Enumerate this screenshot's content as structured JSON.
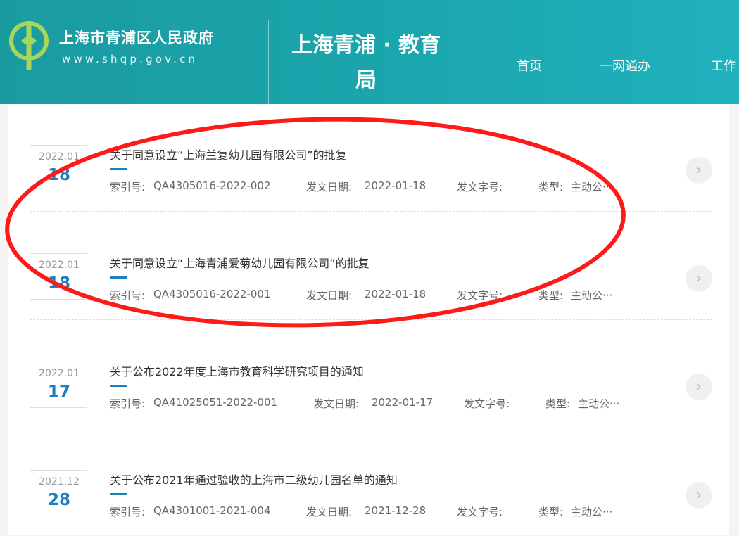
{
  "header": {
    "site_name": "上海市青浦区人民政府",
    "site_url": "www.shqp.gov.cn",
    "dept_title": "上海青浦 · 教育局",
    "nav": [
      "首页",
      "一网通办",
      "工作"
    ],
    "bg_color": "#1aa6ad"
  },
  "list": {
    "labels": {
      "index_prefix": "索引号:",
      "date_prefix": "发文日期:",
      "docno_prefix": "发文字号:",
      "type_prefix": "类型:"
    },
    "items": [
      {
        "year_month": "2022.01",
        "day": "18",
        "title": "关于同意设立“上海兰复幼儿园有限公司”的批复",
        "index_no": "QA4305016-2022-002",
        "date": "2022-01-18",
        "type": "主动公···"
      },
      {
        "year_month": "2022.01",
        "day": "18",
        "title": "关于同意设立“上海青浦爱菊幼儿园有限公司”的批复",
        "index_no": "QA4305016-2022-001",
        "date": "2022-01-18",
        "type": "主动公···"
      },
      {
        "year_month": "2022.01",
        "day": "17",
        "title": "关于公布2022年度上海市教育科学研究项目的通知",
        "index_no": "QA41025051-2022-001",
        "date": "2022-01-17",
        "type": "主动公···"
      },
      {
        "year_month": "2021.12",
        "day": "28",
        "title": "关于公布2021年通过验收的上海市二级幼儿园名单的通知",
        "index_no": "QA4301001-2021-004",
        "date": "2021-12-28",
        "type": "主动公···"
      }
    ]
  },
  "accent_color": "#1e7fc0",
  "annotation_color": "#ff1a1a",
  "icons": {
    "logo": "qingpu-logo-icon",
    "arrow": "chevron-right-icon"
  }
}
